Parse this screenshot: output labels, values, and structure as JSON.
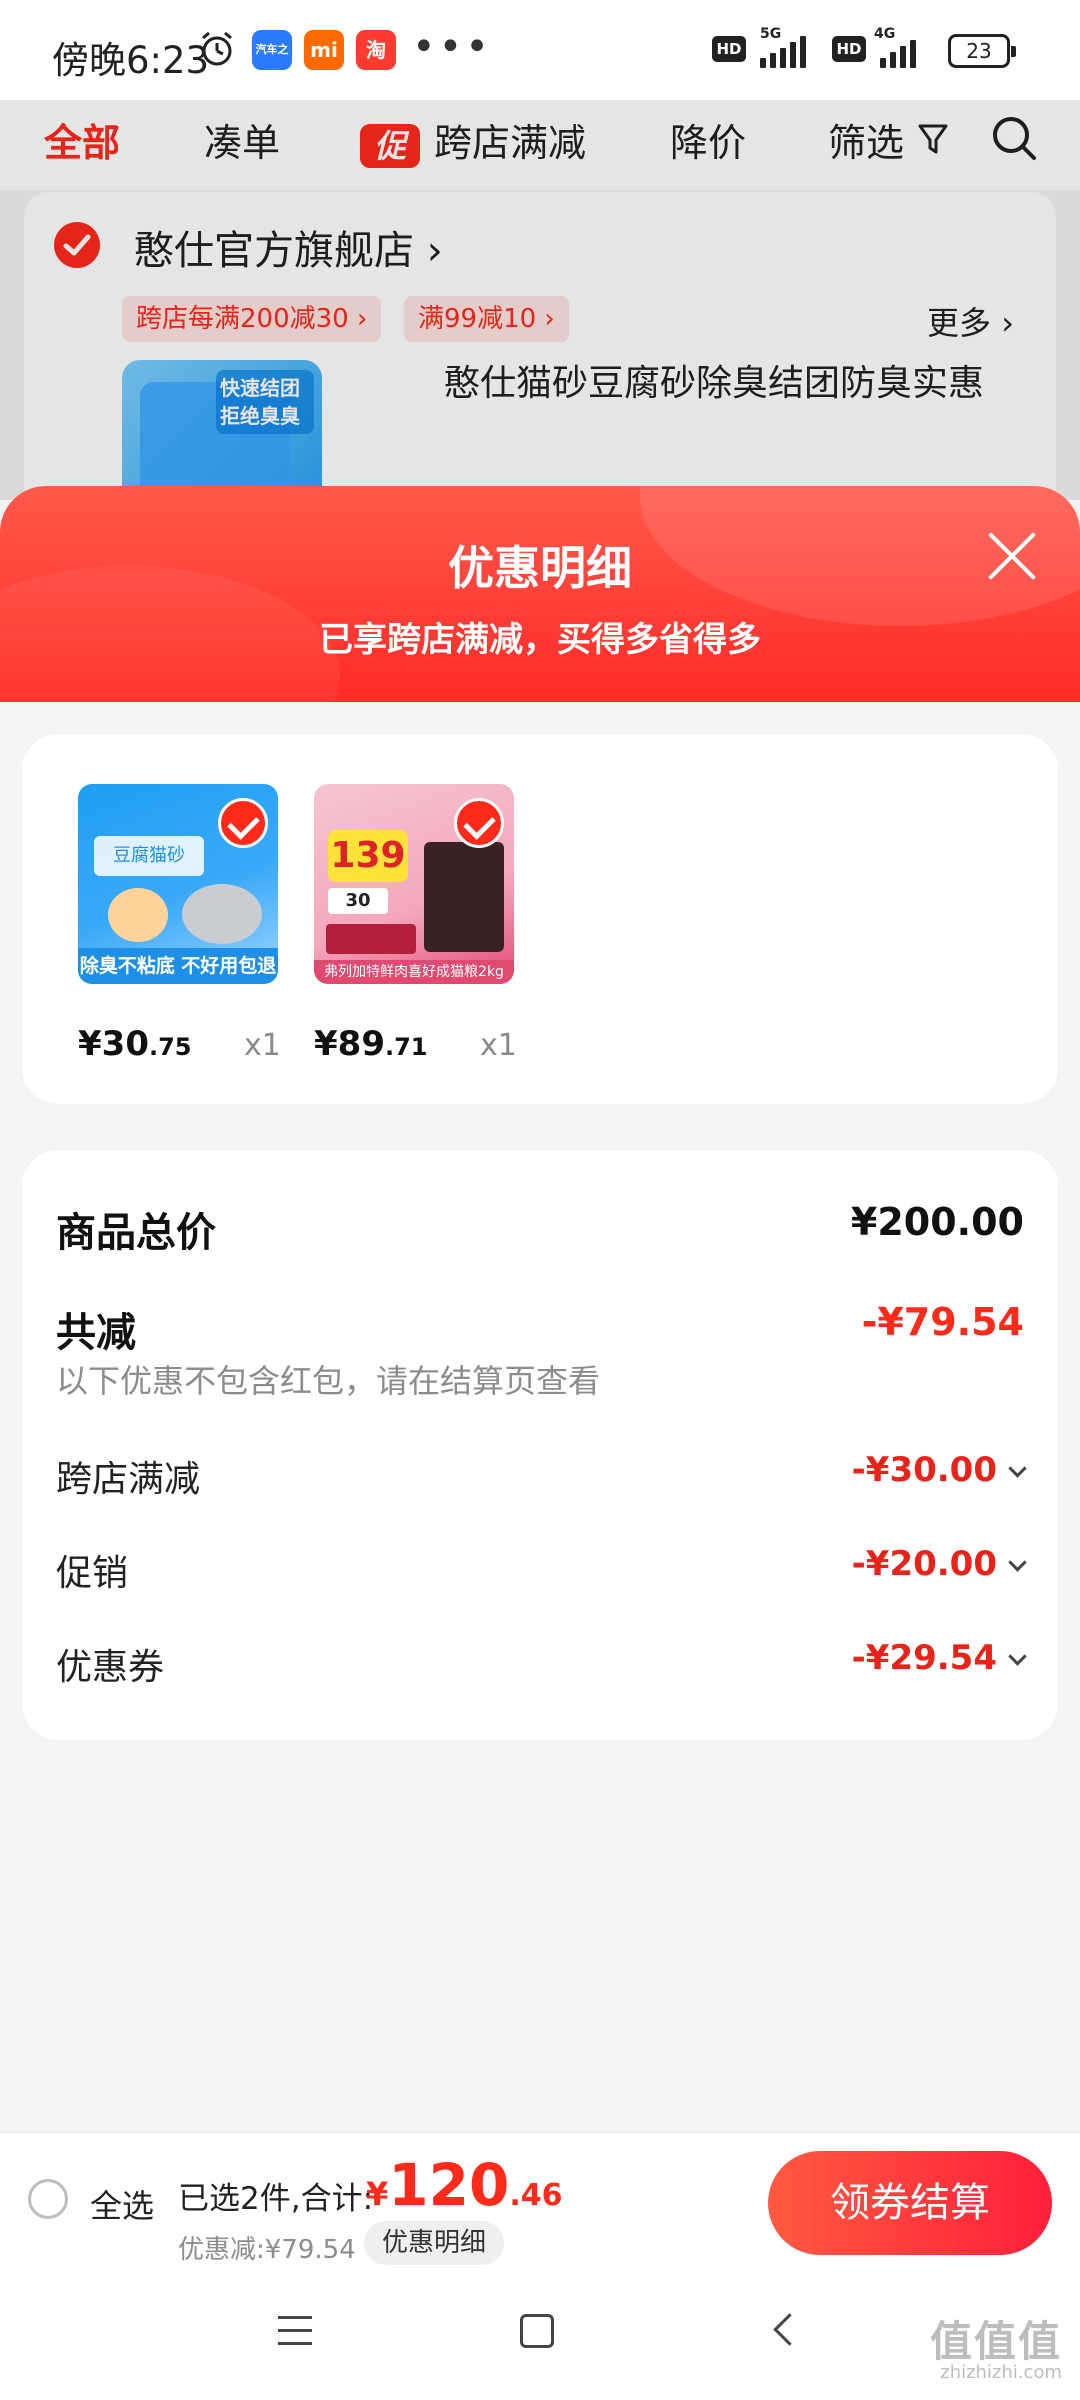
{
  "status_bar": {
    "time": "傍晚6:23",
    "apps": [
      {
        "icon": "car-app-icon",
        "color": "#2a7bff",
        "label": "汽车之家"
      },
      {
        "icon": "mi-app-icon",
        "color": "#ff6a00",
        "label": "mi"
      },
      {
        "icon": "taobao-app-icon",
        "color": "#ff3b2f",
        "label": "淘"
      }
    ],
    "more": "•••",
    "network_1": "5G",
    "network_2": "4G",
    "hd": "HD",
    "battery": "23"
  },
  "filters": {
    "all": "全部",
    "bundle": "凑单",
    "promo_tag": "促",
    "cross_store": "跨店满减",
    "price_drop": "降价",
    "filter": "筛选"
  },
  "shop": {
    "name": "憨仕官方旗舰店",
    "chips": [
      "跨店每满200减30 ›",
      "满99减10 ›"
    ],
    "more": "更多 ›",
    "product_title": "憨仕猫砂豆腐砂除臭结团防臭实惠",
    "thumb_text": "快速结团 拒绝臭臭"
  },
  "sheet": {
    "title": "优惠明细",
    "subtitle": "已享跨店满减，买得多省得多"
  },
  "products": [
    {
      "band": "除臭不粘底 不好用包退",
      "label": "豆腐猫砂",
      "price_int": "¥30",
      "price_dec": ".75",
      "qty": "x1"
    },
    {
      "band": "弗列加特鲜肉喜好成猫粮2kg",
      "big": "139",
      "small": "30",
      "price_int": "¥89",
      "price_dec": ".71",
      "qty": "x1"
    }
  ],
  "summary": {
    "total_label": "商品总价",
    "total_value": "¥200.00",
    "reduced_label": "共减",
    "reduced_value": "-¥79.54",
    "note": "以下优惠不包含红包，请在结算页查看",
    "items": [
      {
        "label": "跨店满减",
        "value": "-¥30.00"
      },
      {
        "label": "促销",
        "value": "-¥20.00"
      },
      {
        "label": "优惠券",
        "value": "-¥29.54"
      }
    ]
  },
  "bottom": {
    "select_all": "全选",
    "selected_text": "已选2件,合计:",
    "currency": "¥",
    "total_int": "120",
    "total_dec": ".46",
    "discount_text": "优惠减:¥79.54",
    "detail_button": "优惠明细",
    "checkout_button": "领券结算"
  },
  "watermark": {
    "text": "值值值",
    "sub": "zhizhizhi.com"
  },
  "colors": {
    "accent": "#ff2a1a",
    "sheet_header": "#ff3a2e",
    "background": "#f4f4f4"
  }
}
